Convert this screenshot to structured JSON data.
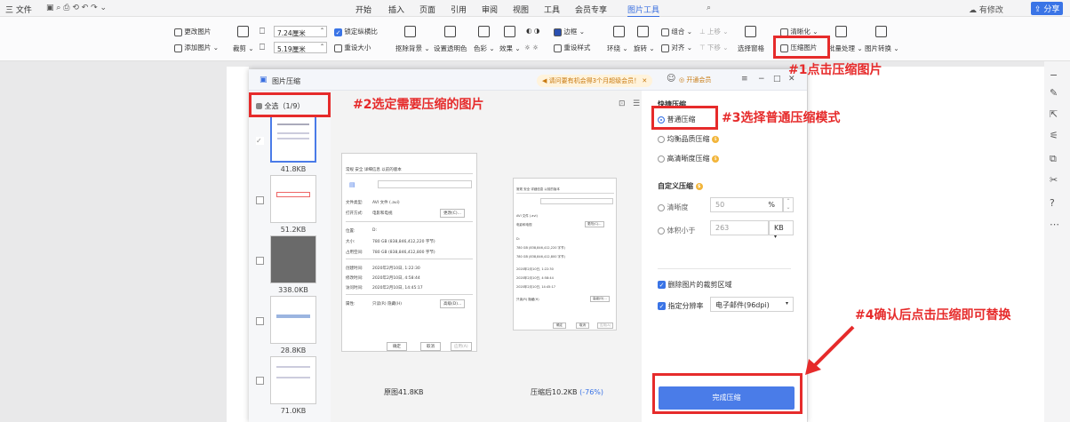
{
  "menubar": {
    "file": "三 文件",
    "tabs": [
      "开始",
      "插入",
      "页面",
      "引用",
      "审阅",
      "视图",
      "工具",
      "会员专享",
      "图片工具"
    ],
    "active_tab": "图片工具",
    "modify": "有修改",
    "share": "分享"
  },
  "ribbon": {
    "change_image": "更改图片",
    "add_image": "添加图片",
    "crop": "裁剪",
    "width": "7.24厘米",
    "height": "5.19厘米",
    "lock_ratio": "锁定纵横比",
    "reset_size": "重设大小",
    "remove_bg": "抠除背景",
    "set_transparent": "设置透明色",
    "color": "色彩",
    "effects": "效果",
    "border": "边框",
    "reset_style": "重设样式",
    "wrap": "环绕",
    "rotate": "旋转",
    "group": "组合",
    "align": "对齐",
    "move_up": "上移",
    "move_down": "下移",
    "selection_pane": "选择窗格",
    "clarify": "清晰化",
    "compress": "压缩图片",
    "batch": "批量处理",
    "convert": "图片转换"
  },
  "dialog": {
    "title": "图片压缩",
    "promo": "请问要有机会得3个月超级会员！",
    "open_member": "开通会员",
    "select_all": "全选（1/9）",
    "thumb_sizes": [
      "41.8KB",
      "51.2KB",
      "338.0KB",
      "28.8KB",
      "71.0KB"
    ],
    "original_label": "原图41.8KB",
    "compressed_label": "压缩后10.2KB",
    "compressed_pct": "(-76%)",
    "quick_title": "快捷压缩",
    "normal": "普通压缩",
    "balanced": "均衡品质压缩",
    "hd": "高清晰度压缩",
    "custom_title": "自定义压缩",
    "clarity": "清晰度",
    "clarity_value": "50",
    "clarity_unit": "%",
    "size_less": "体积小于",
    "size_value": "263",
    "size_unit": "KB",
    "delete_crop": "删除图片的裁剪区域",
    "set_resolution": "指定分辨率",
    "resolution_value": "电子邮件(96dpi)",
    "finish": "完成压缩"
  },
  "preview_text": {
    "tabs": "常规  安全  详细信息  以前的版本",
    "rows": [
      [
        "文件类型:",
        "AVI 文件 (.avi)"
      ],
      [
        "打开方式:",
        "电影和电视"
      ],
      [
        "位置:",
        "D:"
      ],
      [
        "大小:",
        "780 GB (838,846,412,220 字节)"
      ],
      [
        "占用空间:",
        "780 GB (838,846,412,800 字节)"
      ],
      [
        "创建时间:",
        "2020年2月10日, 1:22:30"
      ],
      [
        "修改时间:",
        "2020年2月10日, 4:58:44"
      ],
      [
        "访问时间:",
        "2020年2月10日, 14:45:17"
      ],
      [
        "属性:",
        "只读(R)  隐藏(H)"
      ]
    ],
    "change_btn": "更改(C)...",
    "advanced_btn": "高级(D)...",
    "ok": "确定",
    "cancel": "取消",
    "apply": "应用(A)"
  },
  "annotations": {
    "a1": "#1点击压缩图片",
    "a2": "#2选定需要压缩的图片",
    "a3": "#3选择普通压缩模式",
    "a4": "#4确认后点击压缩即可替换"
  },
  "colors": {
    "accent": "#3a6fe0",
    "annotation": "#e62b2b",
    "button": "#4a7ce8"
  }
}
